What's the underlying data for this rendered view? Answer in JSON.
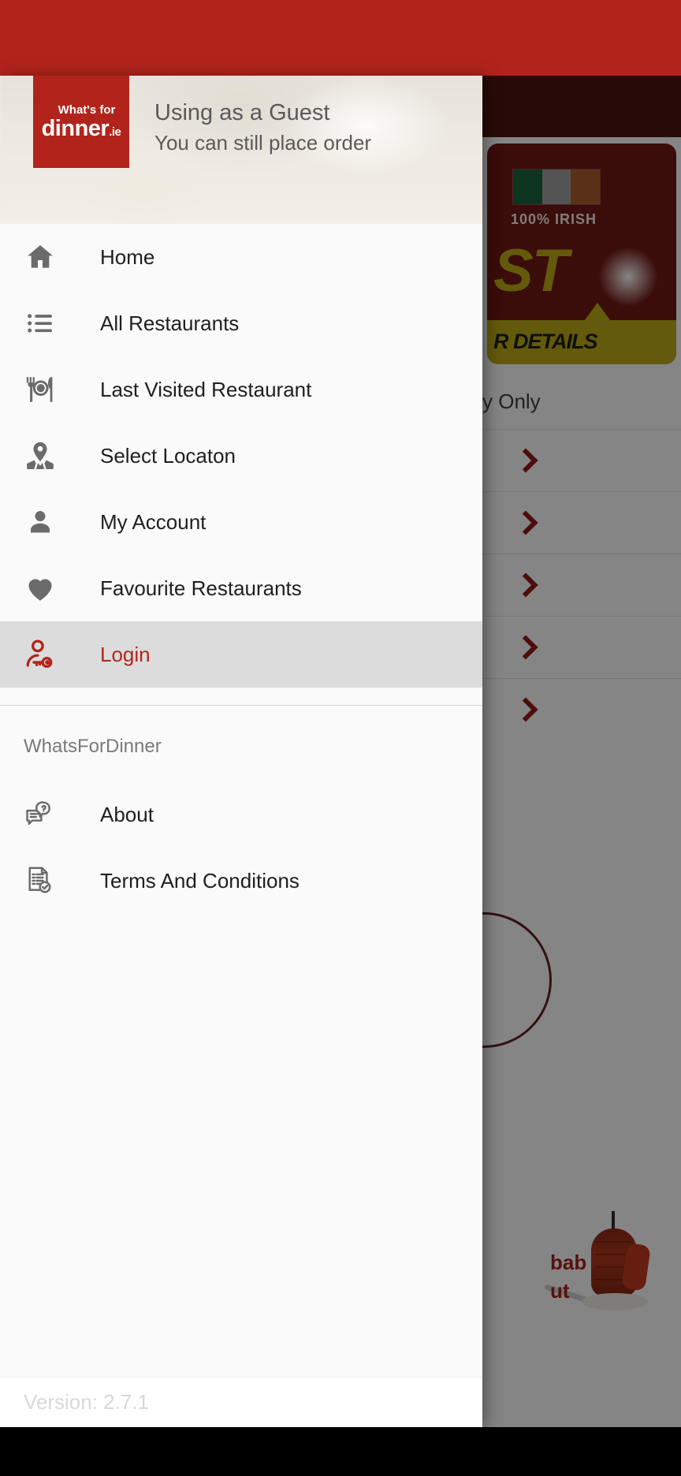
{
  "status_bar": {
    "color": "#b2241b"
  },
  "drawer": {
    "header": {
      "logo_line1": "What's for",
      "logo_line2": "dinner",
      "logo_suffix": ".ie",
      "title": "Using as a Guest",
      "subtitle": "You can still place order"
    },
    "items": [
      {
        "label": "Home",
        "icon": "home-icon",
        "active": false
      },
      {
        "label": "All Restaurants",
        "icon": "list-icon",
        "active": false
      },
      {
        "label": "Last Visited Restaurant",
        "icon": "cutlery-plate-icon",
        "active": false
      },
      {
        "label": "Select Locaton",
        "icon": "map-pin-icon",
        "active": false
      },
      {
        "label": "My Account",
        "icon": "person-icon",
        "active": false
      },
      {
        "label": "Favourite Restaurants",
        "icon": "heart-icon",
        "active": false
      },
      {
        "label": "Login",
        "icon": "person-key-icon",
        "active": true
      }
    ],
    "section_title": "WhatsForDinner",
    "secondary_items": [
      {
        "label": "About",
        "icon": "chat-question-icon"
      },
      {
        "label": "Terms And Conditions",
        "icon": "document-check-icon"
      }
    ],
    "version": "Version: 2.7.1"
  },
  "background": {
    "promo": {
      "irish_label": "100% IRISH",
      "headline_fragment": "ST",
      "footer_fragment": "R DETAILS"
    },
    "collection_label": "y Only",
    "kebab_text_line1": "bab",
    "kebab_text_line2": "ut"
  },
  "colors": {
    "brand_red": "#b2241b",
    "accent_dark_red": "#8c1b15",
    "promo_bg": "#6b1713",
    "promo_gold": "#b5a514",
    "active_row_bg": "#dcdcdc"
  }
}
